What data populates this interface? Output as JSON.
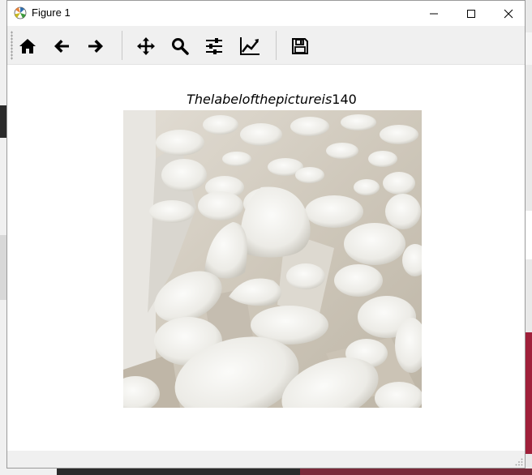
{
  "window": {
    "title": "Figure 1"
  },
  "toolbar": {
    "buttons": [
      {
        "name": "home",
        "icon": "home-icon"
      },
      {
        "name": "back",
        "icon": "arrow-left-icon"
      },
      {
        "name": "forward",
        "icon": "arrow-right-icon"
      },
      {
        "name": "pan",
        "icon": "move-icon"
      },
      {
        "name": "zoom",
        "icon": "zoom-icon"
      },
      {
        "name": "configure-subplots",
        "icon": "sliders-icon"
      },
      {
        "name": "edit-axis",
        "icon": "line-chart-icon"
      },
      {
        "name": "save",
        "icon": "save-icon"
      }
    ]
  },
  "figure": {
    "title_italic": "Thelabelofthepictureis",
    "title_number": "140"
  },
  "colors": {
    "toolbar_bg": "#f0f0f0",
    "canvas_bg": "#ffffff",
    "icon": "#000000"
  }
}
